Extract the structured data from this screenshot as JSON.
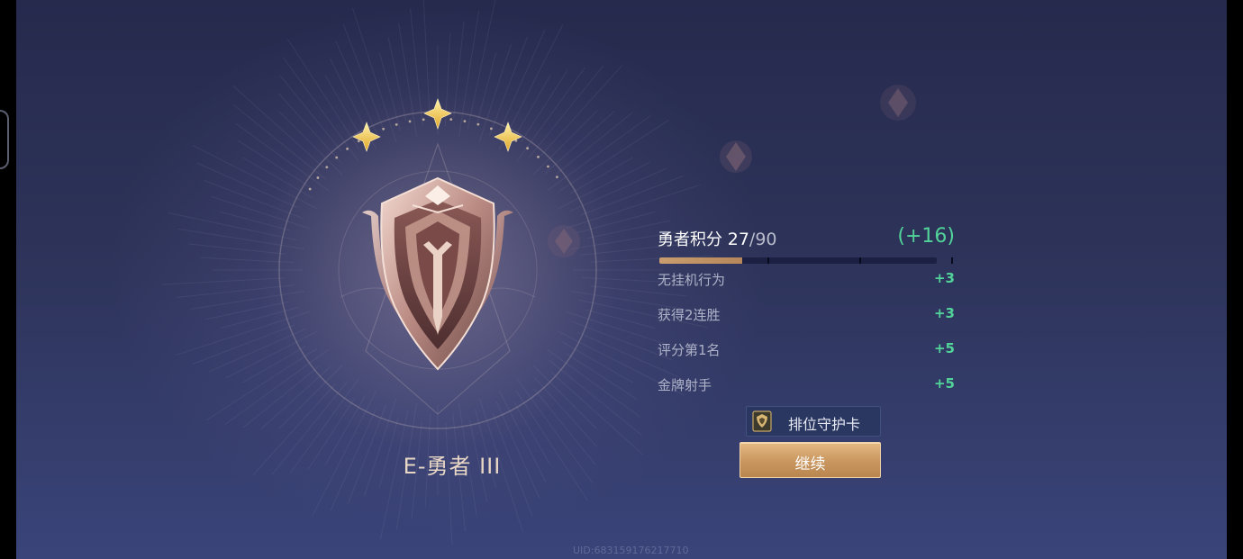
{
  "rank": {
    "name": "E-勇者 III",
    "stars": 3
  },
  "score": {
    "label": "勇者积分",
    "current": "27",
    "separator": "/",
    "max": "90",
    "gain": "(+16)",
    "progress_fraction": 0.3
  },
  "bonuses": [
    {
      "label": "无挂机行为",
      "value": "+3"
    },
    {
      "label": "获得2连胜",
      "value": "+3"
    },
    {
      "label": "评分第1名",
      "value": "+5"
    },
    {
      "label": "金牌射手",
      "value": "+5"
    }
  ],
  "guard_card": {
    "label": "排位守护卡"
  },
  "continue_button": {
    "label": "继续"
  },
  "uid": "UID:683159176217710",
  "colors": {
    "accent_green": "#52d39a",
    "gold": "#c99d6e"
  }
}
